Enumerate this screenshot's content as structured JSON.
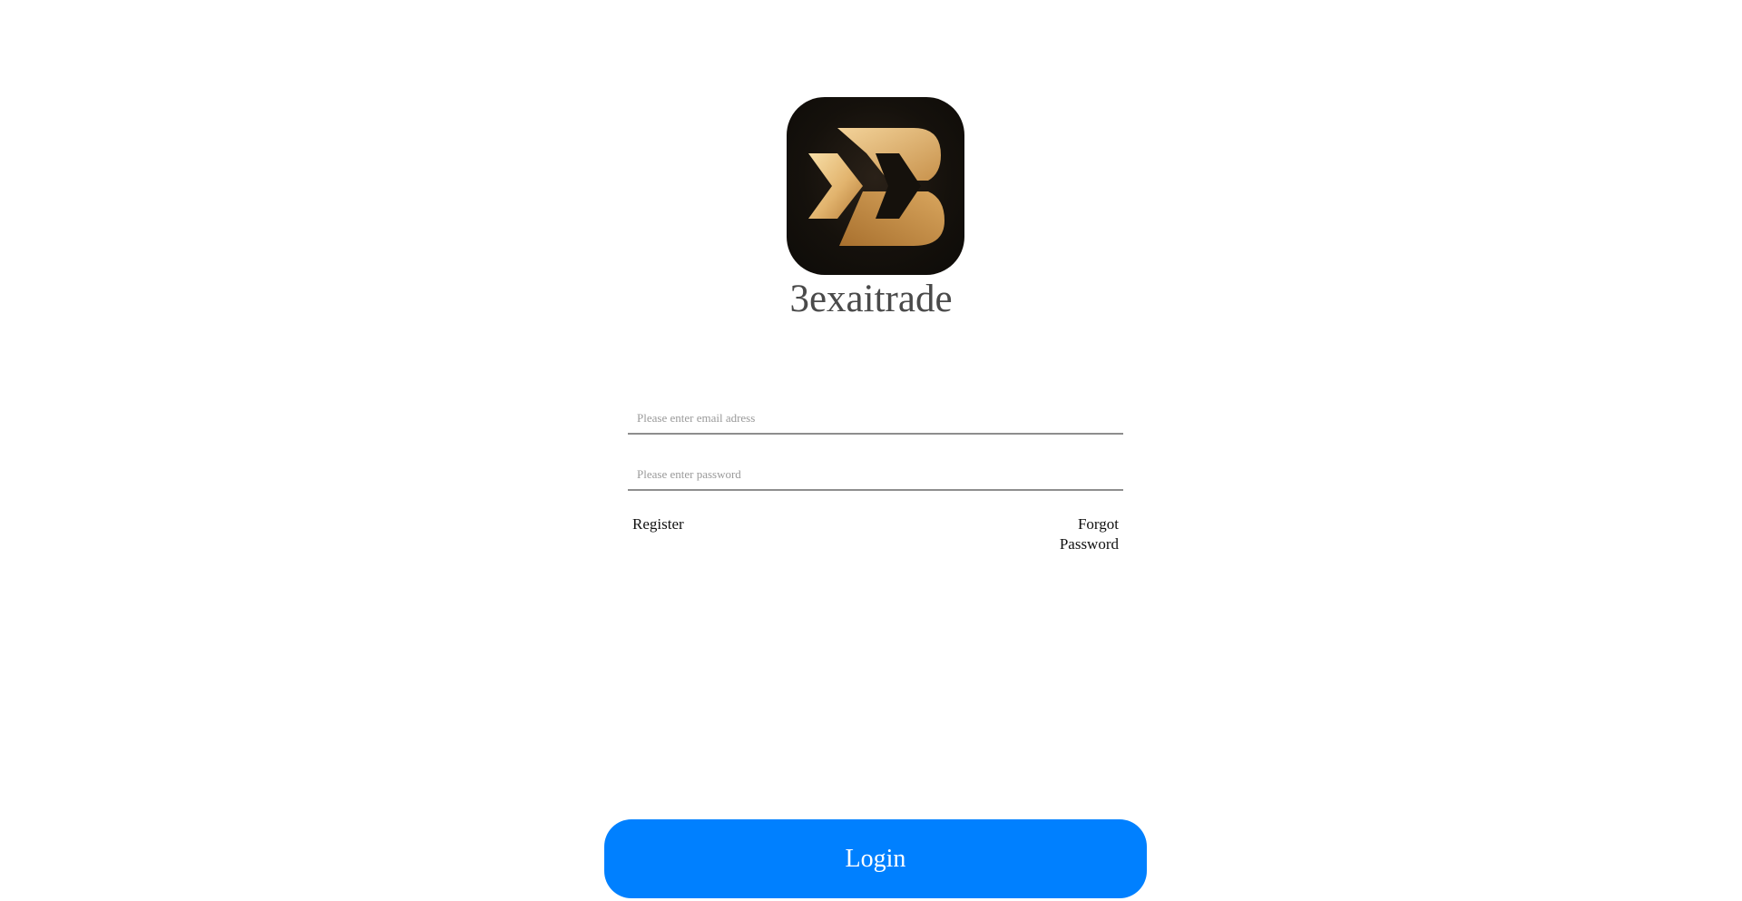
{
  "brand": {
    "name": "3exaitrade",
    "logo_icon": "gold-x-b-monogram-icon",
    "logo_colors": {
      "background": "#121212",
      "gold_light": "#f3d39a",
      "gold_dark": "#b47a36"
    }
  },
  "form": {
    "email": {
      "placeholder": "Please enter email adress",
      "value": ""
    },
    "password": {
      "placeholder": "Please enter password",
      "value": ""
    }
  },
  "links": {
    "register": "Register",
    "forgot_password": "Forgot Password"
  },
  "login_button": {
    "label": "Login",
    "color": "#0080ff"
  }
}
